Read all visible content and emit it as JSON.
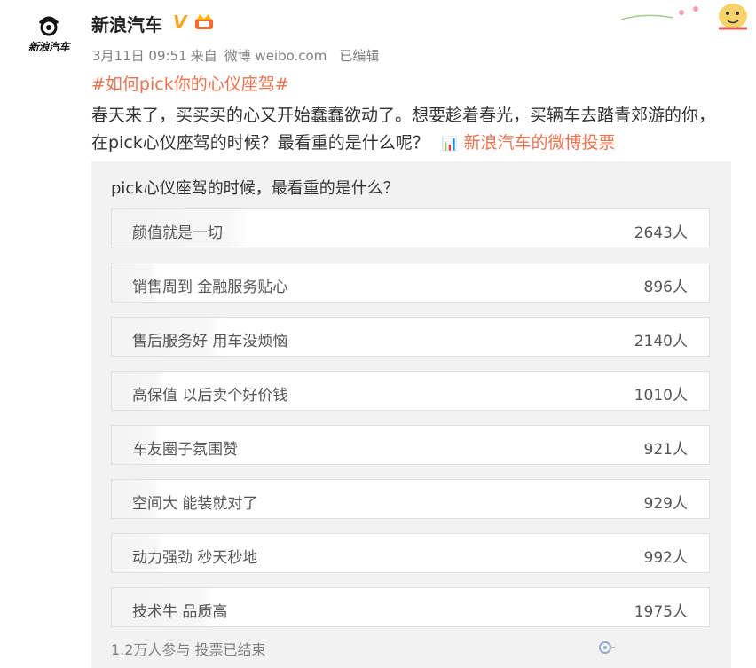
{
  "account": {
    "name": "新浪汽车",
    "verified_mark": "V",
    "logo_brand": "新浪汽车",
    "verified_color": "#f5a623"
  },
  "meta": {
    "date": "3月11日 09:51",
    "source_prefix": "来自",
    "source": "微博 weibo.com",
    "edited": "已编辑"
  },
  "post": {
    "hashtag": "#如何pick你的心仪座驾#",
    "text": "春天来了，买买买的心又开始蠢蠢欲动了。想要趁着春光，买辆车去踏青郊游的你，在pick心仪座驾的时候？最看重的是什么呢？",
    "vote_link_icon": "bar-chart-icon",
    "vote_link": "新浪汽车的微博投票",
    "link_color": "#eb7350"
  },
  "poll": {
    "question": "pick心仪座驾的时候，最看重的是什么？",
    "options": [
      {
        "label": "颜值就是一切",
        "count": "2643人",
        "votes": 2643
      },
      {
        "label": "销售周到 金融服务贴心",
        "count": "896人",
        "votes": 896
      },
      {
        "label": "售后服务好 用车没烦恼",
        "count": "2140人",
        "votes": 2140
      },
      {
        "label": "高保值 以后卖个好价钱",
        "count": "1010人",
        "votes": 1010
      },
      {
        "label": "车友圈子氛围赞",
        "count": "921人",
        "votes": 921
      },
      {
        "label": "空间大 能装就对了",
        "count": "929人",
        "votes": 929
      },
      {
        "label": "动力强劲 秒天秒地",
        "count": "992人",
        "votes": 992
      },
      {
        "label": "技术牛 品质高",
        "count": "1975人",
        "votes": 1975
      }
    ],
    "footer": "1.2万人参与 投票已结束"
  }
}
